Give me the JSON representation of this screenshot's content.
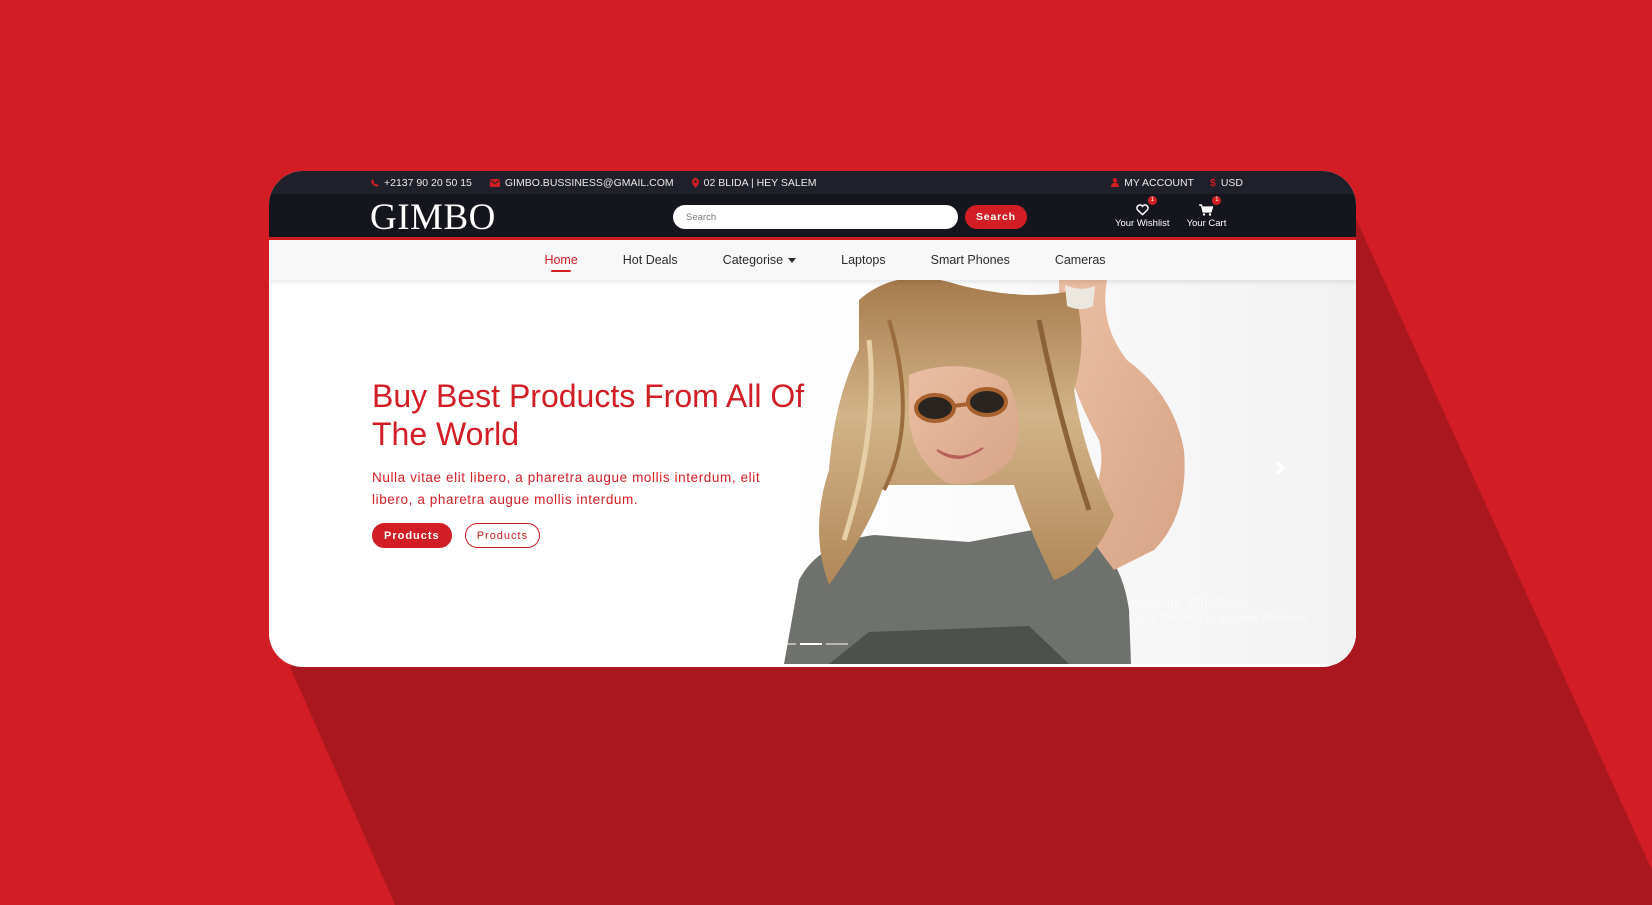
{
  "colors": {
    "brand_red": "#d21d24",
    "topbar": "#1f2029",
    "header": "#15161d",
    "nav_bg": "#f8f8f9"
  },
  "topbar": {
    "phone": "+2137 90 20 50 15",
    "email": "GIMBO.BUSSINESS@GMAIL.COM",
    "address": "02 BLIDA | HEY SALEM",
    "account": "MY ACCOUNT",
    "currency": "USD",
    "icons": [
      "phone-icon",
      "envelope-icon",
      "map-marker-icon",
      "user-icon",
      "dollar-icon"
    ]
  },
  "header": {
    "logo": "GIMBO",
    "search": {
      "placeholder": "Search",
      "value": "",
      "button": "Search"
    },
    "wishlist": {
      "label": "Your Wishlist",
      "count": "1",
      "icon": "heart-icon"
    },
    "cart": {
      "label": "Your Cart",
      "count": "1",
      "icon": "shopping-cart-icon"
    }
  },
  "nav": {
    "items": [
      {
        "label": "Home",
        "active": true
      },
      {
        "label": "Hot Deals"
      },
      {
        "label": "Categorise",
        "dropdown": true
      },
      {
        "label": "Laptops"
      },
      {
        "label": "Smart Phones"
      },
      {
        "label": "Cameras"
      }
    ]
  },
  "hero": {
    "title": "Buy Best Products From All Of The World",
    "text": "Nulla vitae elit libero, a pharetra augue mollis interdum, elit libero, a pharetra augue mollis interdum.",
    "primary_button": "Products",
    "secondary_button": "Products",
    "next_icon": "chevron-right-icon",
    "slides": 3,
    "active_slide": 2
  },
  "watermark": {
    "title": "Activate Windows",
    "subtitle": "Go to Settings to activate Windows."
  }
}
